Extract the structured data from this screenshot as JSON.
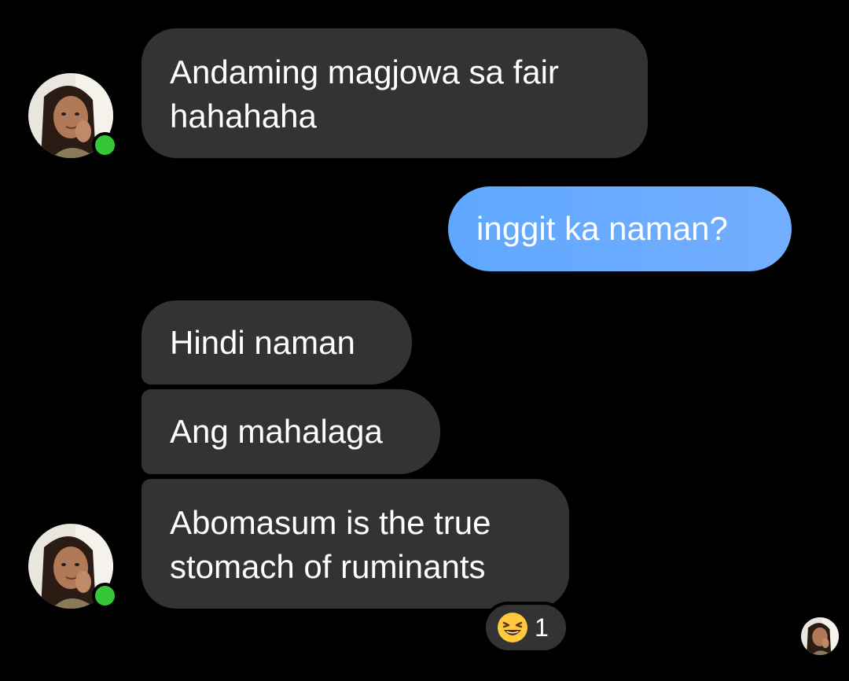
{
  "conversation": {
    "messages": [
      {
        "sender": "contact",
        "lines": [
          "Andaming magjowa sa fair",
          "hahahaha"
        ]
      },
      {
        "sender": "self",
        "lines": [
          "inggit ka naman?"
        ]
      },
      {
        "sender": "contact",
        "lines": [
          "Hindi naman"
        ]
      },
      {
        "sender": "contact",
        "lines": [
          "Ang mahalaga"
        ]
      },
      {
        "sender": "contact",
        "lines": [
          "Abomasum is the true",
          "stomach of ruminants"
        ]
      }
    ],
    "reaction": {
      "icon": "laughing-emoji-icon",
      "count": "1"
    }
  },
  "theme": {
    "background": "#000000",
    "incoming_bubble": "#333333",
    "outgoing_bubble": "#6aaaff",
    "online_indicator": "#36c739"
  }
}
